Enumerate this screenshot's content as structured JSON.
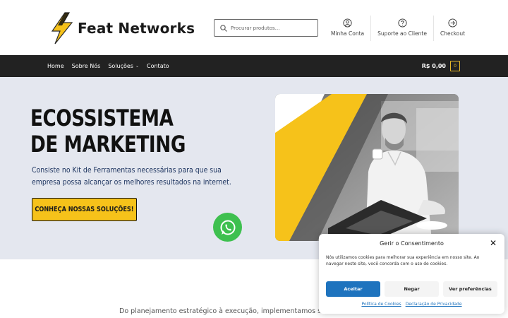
{
  "header": {
    "brand": "Feat Networks",
    "search_placeholder": "Procurar produtos…",
    "links": [
      {
        "label": "Minha Conta",
        "icon": "user-icon"
      },
      {
        "label": "Suporte ao Cliente",
        "icon": "help-icon"
      },
      {
        "label": "Checkout",
        "icon": "arrow-right-icon"
      }
    ]
  },
  "nav": {
    "items": [
      "Home",
      "Sobre Nós",
      "Soluções",
      "Contato"
    ],
    "cart_total": "R$ 0,00",
    "cart_count": "0"
  },
  "hero": {
    "title": "ECOSSISTEMA DE MARKETING",
    "description": "Consiste no Kit de Ferramentas necessárias para que sua empresa possa alcançar os melhores resultados na internet.",
    "cta": "CONHEÇA NOSSAS SOLUÇÕES!"
  },
  "section": {
    "subtitle": "Do planejamento estratégico à execução, implementamos solu"
  },
  "cookie": {
    "title": "Gerir o Consentimento",
    "text": "Nós utilizamos cookies para melhorar sua experiência em nosso site. Ao navegar neste site, você concorda com o uso de cookies.",
    "accept": "Aceitar",
    "deny": "Negar",
    "prefs": "Ver preferências",
    "link_cookies": "Política de Cookies",
    "link_privacy": "Declaração de Privacidade"
  },
  "colors": {
    "accent_yellow": "#f6c21a",
    "nav_bg": "#222222",
    "hero_bg": "#e4e7ef",
    "whatsapp_green": "#3ec04f",
    "cookie_blue": "#1e73be"
  }
}
